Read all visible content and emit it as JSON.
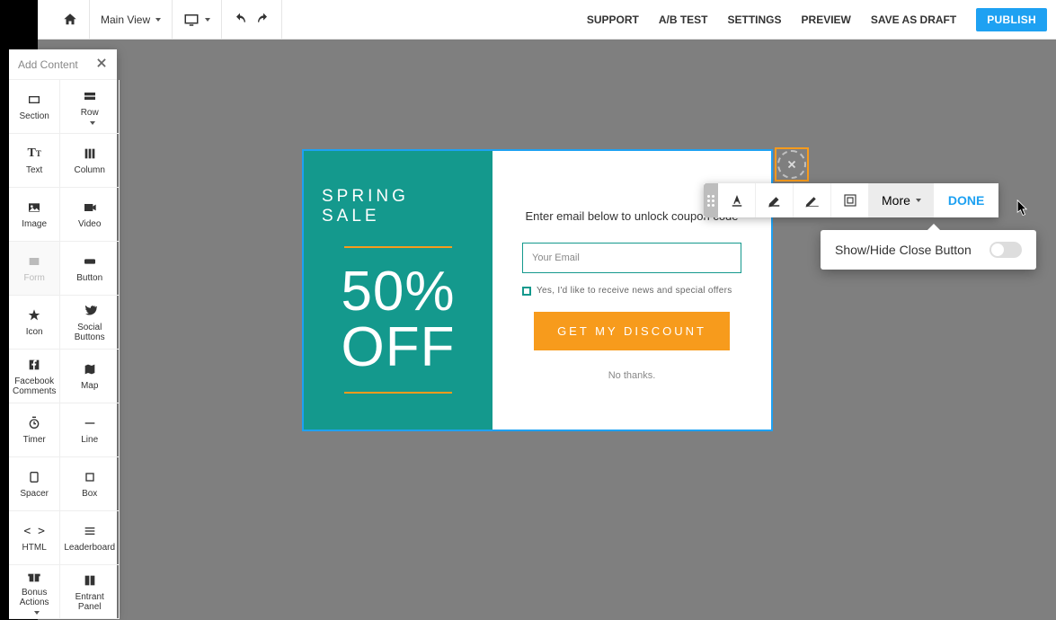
{
  "topbar": {
    "main_view": "Main View",
    "support": "SUPPORT",
    "abtest": "A/B TEST",
    "settings": "SETTINGS",
    "preview": "PREVIEW",
    "save_draft": "SAVE AS DRAFT",
    "publish": "PUBLISH"
  },
  "sidebar": {
    "title": "Add Content",
    "items": [
      {
        "label": "Section"
      },
      {
        "label": "Row"
      },
      {
        "label": "Text"
      },
      {
        "label": "Column"
      },
      {
        "label": "Image"
      },
      {
        "label": "Video"
      },
      {
        "label": "Form"
      },
      {
        "label": "Button"
      },
      {
        "label": "Icon"
      },
      {
        "label": "Social Buttons"
      },
      {
        "label": "Facebook Comments"
      },
      {
        "label": "Map"
      },
      {
        "label": "Timer"
      },
      {
        "label": "Line"
      },
      {
        "label": "Spacer"
      },
      {
        "label": "Box"
      },
      {
        "label": "HTML"
      },
      {
        "label": "Leaderboard"
      },
      {
        "label": "Bonus Actions"
      },
      {
        "label": "Entrant Panel"
      }
    ]
  },
  "popup": {
    "title": "SPRING SALE",
    "discount": "50% OFF",
    "sub": "Enter email below to unlock coupon code",
    "email_ph": "Your Email",
    "checkbox": "Yes, I'd like to receive news and special offers",
    "cta": "GET MY DISCOUNT",
    "nothanks": "No thanks."
  },
  "editor": {
    "more": "More",
    "done": "DONE"
  },
  "dropdown": {
    "show_hide": "Show/Hide Close Button"
  }
}
